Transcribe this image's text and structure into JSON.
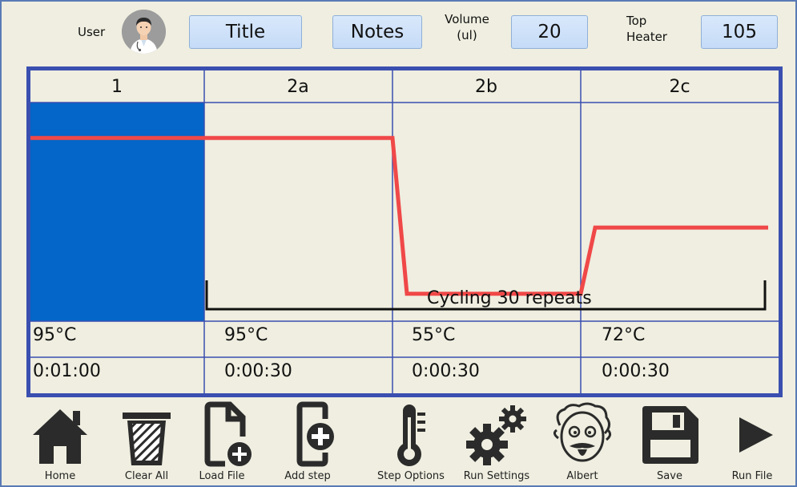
{
  "header": {
    "user_label": "User",
    "title_button": "Title",
    "notes_button": "Notes",
    "volume_label_line1": "Volume",
    "volume_label_line2": "(ul)",
    "volume_value": "20",
    "top_heater_label_line1": "Top",
    "top_heater_label_line2": "Heater",
    "top_heater_value": "105"
  },
  "program": {
    "active_step": "1",
    "cycling_label": "Cycling 30 repeats",
    "steps": [
      {
        "name": "1",
        "temperature": "95°C",
        "time": "0:01:00",
        "temp_c": 95
      },
      {
        "name": "2a",
        "temperature": "95°C",
        "time": "0:00:30",
        "temp_c": 95
      },
      {
        "name": "2b",
        "temperature": "55°C",
        "time": "0:00:30",
        "temp_c": 55
      },
      {
        "name": "2c",
        "temperature": "72°C",
        "time": "0:00:30",
        "temp_c": 72
      }
    ]
  },
  "colors": {
    "frame": "#3a4fb0",
    "active_step": "#0366c8",
    "temperature_line": "#f04848",
    "button_bg": "#d2e4fa"
  },
  "toolbar": {
    "items": [
      {
        "label": "Home",
        "icon": "home-icon"
      },
      {
        "label": "Clear All",
        "icon": "trash-icon"
      },
      {
        "label": "Load File",
        "icon": "load-file-icon"
      },
      {
        "label": "Add step",
        "icon": "add-step-icon"
      },
      {
        "label": "Step Options",
        "icon": "thermometer-icon"
      },
      {
        "label": "Run Settings",
        "icon": "gears-icon"
      },
      {
        "label": "Albert",
        "icon": "albert-icon"
      },
      {
        "label": "Save",
        "icon": "floppy-icon"
      },
      {
        "label": "Run File",
        "icon": "play-icon"
      }
    ]
  }
}
